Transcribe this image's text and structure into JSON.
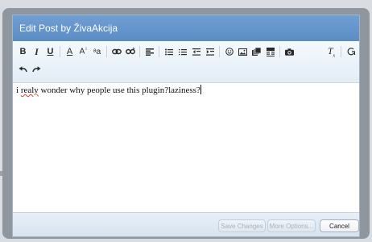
{
  "dialog": {
    "title": "Edit Post by ŽivaAkcija"
  },
  "toolbar": {
    "row1": [
      "bold-button",
      "italic-button",
      "underline-button",
      "text-color-button",
      "font-size-button",
      "font-family-button",
      "link-button",
      "unlink-button",
      "align-button",
      "bulleted-list-button",
      "numbered-list-button",
      "outdent-button",
      "indent-button",
      "smilies-button",
      "image-button",
      "media-button",
      "quote-button",
      "camera-button",
      "remove-format-button",
      "switch-bbcode-button"
    ],
    "row2": [
      "undo-button",
      "redo-button"
    ]
  },
  "editor": {
    "text_before": "i ",
    "text_misspelled": "realy",
    "text_after": " wonder why people use this plugin?laziness?"
  },
  "footer": {
    "save_label": "Save Changes",
    "more_label": "More Options...",
    "cancel_label": "Cancel"
  },
  "colors": {
    "title_bar": "#5b8cc4",
    "overlay": "#8f969e",
    "spell_underline": "#e53935"
  }
}
